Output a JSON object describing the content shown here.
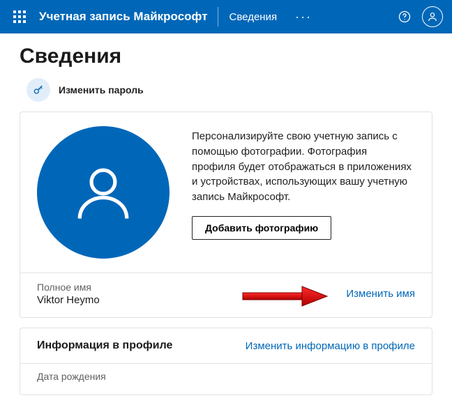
{
  "header": {
    "brand": "Учетная запись Майкрософт",
    "nav_item": "Сведения"
  },
  "page": {
    "title": "Сведения",
    "change_password": "Изменить пароль"
  },
  "profile": {
    "description": "Персонализируйте свою учетную запись с помощью фотографии. Фотография профиля будет отображаться в приложениях и устройствах, использующих вашу учетную запись Майкрософт.",
    "add_photo": "Добавить фотографию",
    "full_name_label": "Полное имя",
    "full_name_value": "Viktor Heymo",
    "edit_name": "Изменить имя"
  },
  "info": {
    "title": "Информация в профиле",
    "edit_link": "Изменить информацию в профиле",
    "dob_label": "Дата рождения"
  }
}
